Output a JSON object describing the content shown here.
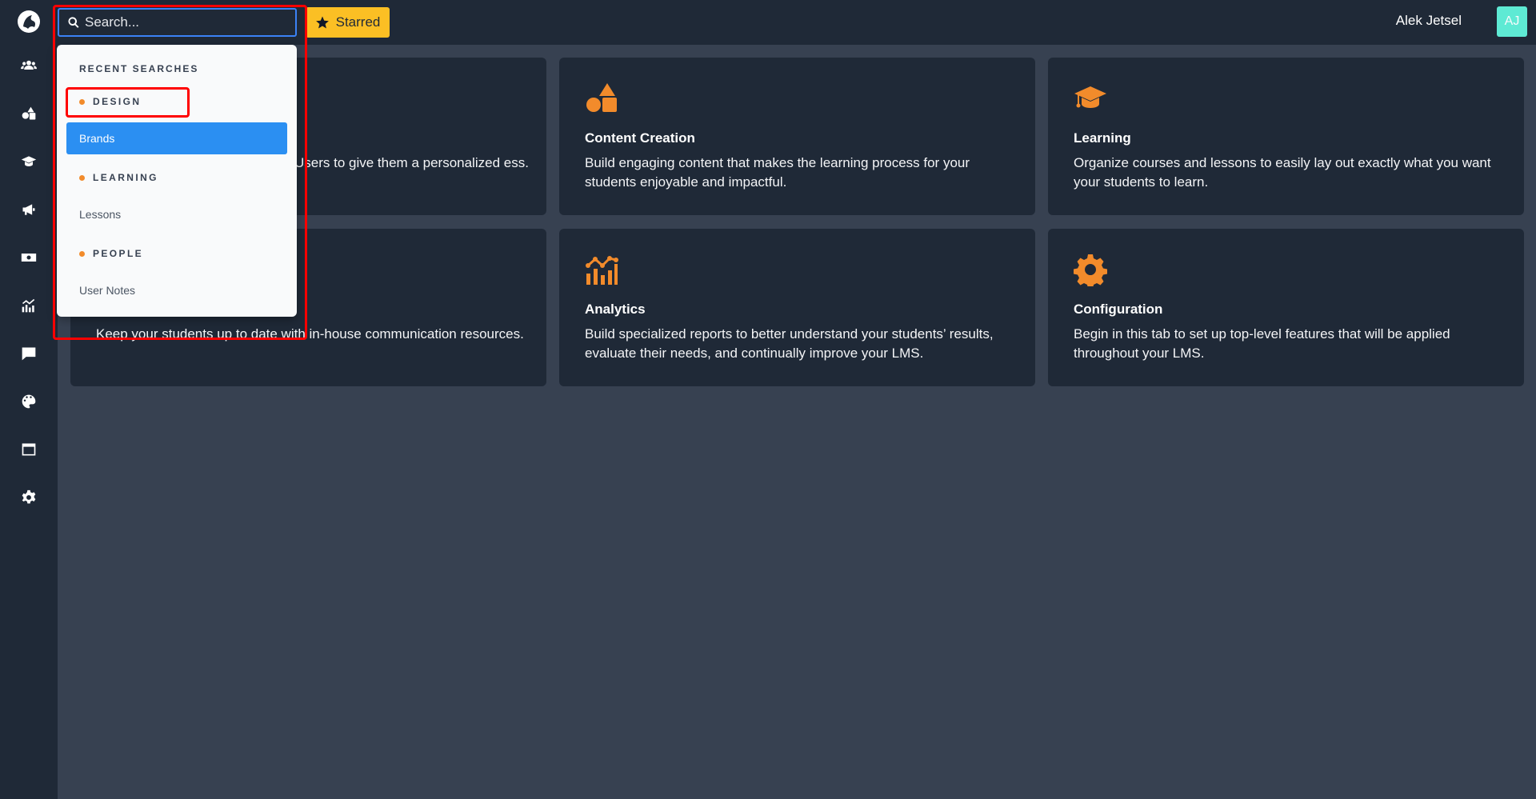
{
  "search": {
    "placeholder": "Search...",
    "value": ""
  },
  "header": {
    "starred_label": "Starred",
    "user_name": "Alek Jetsel",
    "user_initials": "AJ"
  },
  "sidebar": {
    "items": [
      {
        "icon": "users-icon"
      },
      {
        "icon": "shapes-icon"
      },
      {
        "icon": "graduation-cap-icon"
      },
      {
        "icon": "bullhorn-icon"
      },
      {
        "icon": "money-bill-icon"
      },
      {
        "icon": "chart-icon"
      },
      {
        "icon": "comment-icon"
      },
      {
        "icon": "palette-icon"
      },
      {
        "icon": "window-icon"
      },
      {
        "icon": "gear-icon"
      }
    ]
  },
  "dropdown": {
    "header": "RECENT SEARCHES",
    "groups": [
      {
        "label": "DESIGN",
        "items": [
          "Brands"
        ]
      },
      {
        "label": "LEARNING",
        "items": [
          "Lessons"
        ]
      },
      {
        "label": "PEOPLE",
        "items": [
          "User Notes"
        ]
      }
    ]
  },
  "cards": [
    {
      "icon": "users-icon",
      "title": "",
      "desc": "Users to give them a personalized ess."
    },
    {
      "icon": "shapes-icon",
      "title": "Content Creation",
      "desc": "Build engaging content that makes the learning process for your students enjoyable and impactful."
    },
    {
      "icon": "graduation-cap-icon",
      "title": "Learning",
      "desc": "Organize courses and lessons to easily lay out exactly what you want your students to learn."
    },
    {
      "icon": "bullhorn-icon",
      "title": "",
      "desc": "Keep your students up to date with in-house communication resources."
    },
    {
      "icon": "chart-icon",
      "title": "Analytics",
      "desc": "Build specialized reports to better understand your students’ results, evaluate their needs, and continually improve your LMS."
    },
    {
      "icon": "gear-icon",
      "title": "Configuration",
      "desc": "Begin in this tab to set up top-level features that will be applied throughout your LMS."
    }
  ],
  "colors": {
    "accent": "#f28b2b",
    "selected": "#2b8ff2",
    "starred": "#fbbf24",
    "avatar": "#5eead4",
    "annotation": "#ff0000"
  }
}
